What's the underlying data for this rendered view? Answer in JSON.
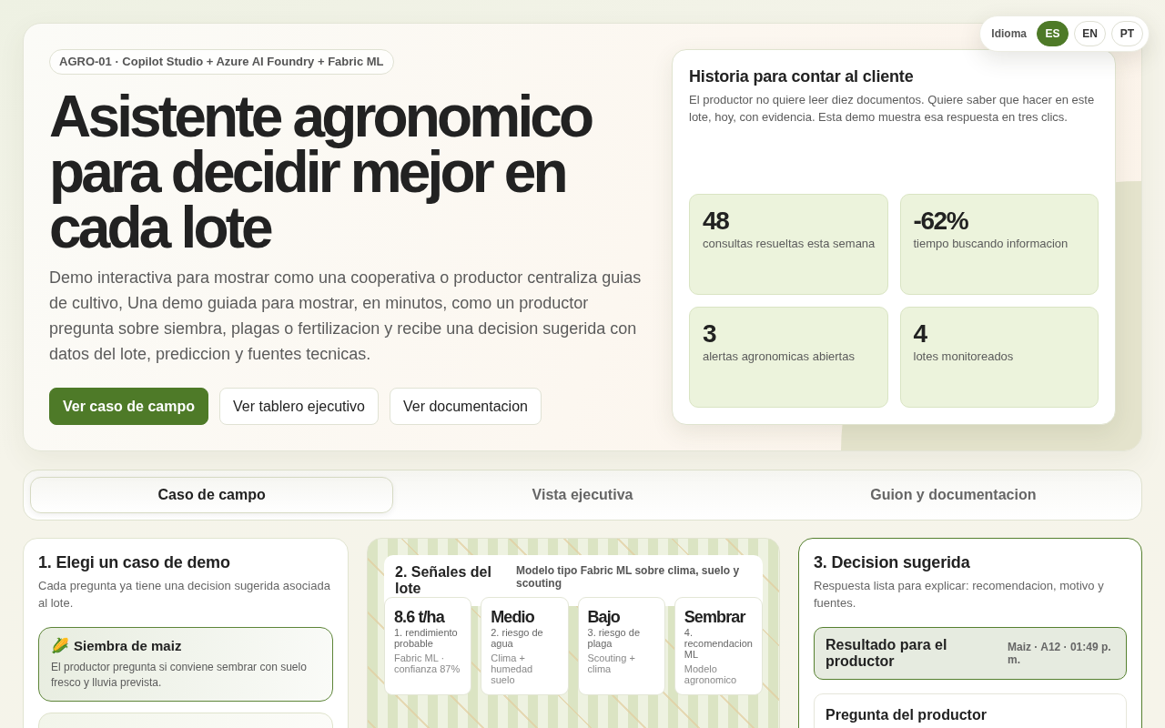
{
  "language_switcher": {
    "label": "Idioma",
    "options": [
      {
        "label": "ES",
        "selected": true
      },
      {
        "label": "EN",
        "selected": false
      },
      {
        "label": "PT",
        "selected": false
      }
    ]
  },
  "hero": {
    "tag": "AGRO-01 · Copilot Studio + Azure AI Foundry + Fabric ML",
    "title": "Asistente agronomico para decidir mejor en cada lote",
    "description": "Demo interactiva para mostrar como una cooperativa o productor centraliza guias de cultivo, Una demo guiada para mostrar, en minutos, como un productor pregunta sobre siembra, plagas o fertilizacion y recibe una decision sugerida con datos del lote, prediccion y fuentes tecnicas.",
    "buttons": [
      {
        "label": "Ver caso de campo",
        "kind": "primary"
      },
      {
        "label": "Ver tablero ejecutivo",
        "kind": "secondary"
      },
      {
        "label": "Ver documentacion",
        "kind": "secondary"
      }
    ]
  },
  "story_card": {
    "title": "Historia para contar al cliente",
    "description": "El productor no quiere leer diez documentos. Quiere saber que hacer en este lote, hoy, con evidencia. Esta demo muestra esa respuesta en tres clics.",
    "stats": [
      {
        "value": "48",
        "label": "consultas resueltas esta semana"
      },
      {
        "value": "-62%",
        "label": "tiempo buscando informacion"
      },
      {
        "value": "3",
        "label": "alertas agronomicas abiertas"
      },
      {
        "value": "4",
        "label": "lotes monitoreados"
      }
    ]
  },
  "tabs": [
    {
      "label": "Caso de campo",
      "selected": true
    },
    {
      "label": "Vista ejecutiva",
      "selected": false
    },
    {
      "label": "Guion y documentacion",
      "selected": false
    }
  ],
  "demo_cases": {
    "title": "1. Elegi un caso de demo",
    "description": "Cada pregunta ya tiene una decision sugerida asociada al lote.",
    "cases": [
      {
        "icon": "🌽",
        "title": "Siembra de maiz",
        "description": "El productor pregunta si conviene sembrar con suelo fresco y lluvia prevista.",
        "selected": true
      },
      {
        "selected": false
      }
    ]
  },
  "signals": {
    "title": "2. Señales del lote",
    "subtitle": "Modelo tipo Fabric ML sobre clima, suelo y scouting",
    "cards": [
      {
        "value": "8.6 t/ha",
        "label": "1. rendimiento probable",
        "source": "Fabric ML · confianza 87%"
      },
      {
        "value": "Medio",
        "label": "2. riesgo de agua",
        "source": "Clima + humedad suelo"
      },
      {
        "value": "Bajo",
        "label": "3. riesgo de plaga",
        "source": "Scouting + clima"
      },
      {
        "value": "Sembrar",
        "label": "4. recomendacion ML",
        "source": "Modelo agronomico"
      }
    ]
  },
  "decision": {
    "title": "3. Decision sugerida",
    "description": "Respuesta lista para explicar: recomendacion, motivo y fuentes.",
    "result": {
      "title": "Resultado para el productor",
      "meta": "Maiz · A12 · 01:49 p. m."
    },
    "question": {
      "title": "Pregunta del productor"
    }
  }
}
